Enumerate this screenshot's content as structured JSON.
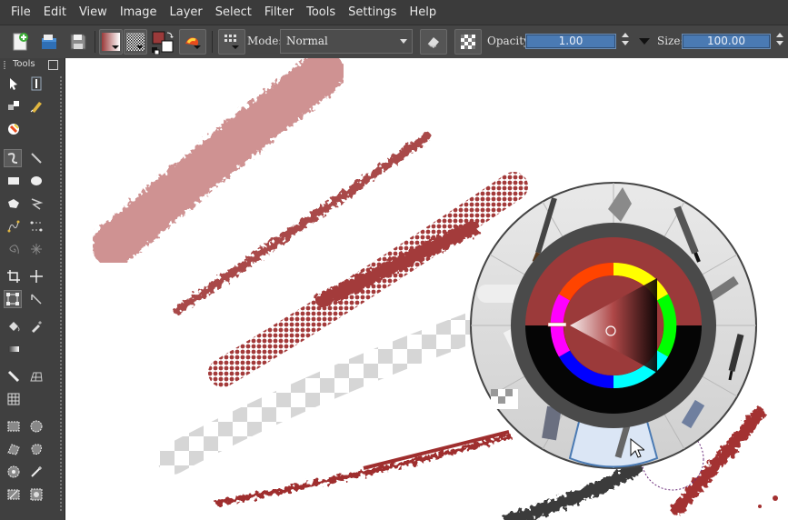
{
  "menu": [
    "File",
    "Edit",
    "View",
    "Image",
    "Layer",
    "Select",
    "Filter",
    "Tools",
    "Settings",
    "Help"
  ],
  "toolbar": {
    "mode_label": "Mode:",
    "blend_mode": "Normal",
    "opacity_label": "Opacity:",
    "opacity_value": "1.00",
    "size_label": "Size:",
    "size_value": "100.00"
  },
  "tools_panel": {
    "title": "Tools"
  },
  "colors": {
    "foreground": "#9b3a3a",
    "background": "#ffffff",
    "accent": "#4a7ab3",
    "panel": "#404040"
  },
  "icons": [
    "new-document-icon",
    "open-icon",
    "save-icon",
    "gradient-icon",
    "pattern-icon",
    "swap-colors-icon",
    "brush-preset-icon",
    "grid-icon",
    "eraser-icon",
    "alpha-lock-icon"
  ],
  "popup_palette": {
    "current_color": "#9b3a3a",
    "brush_presets": 12
  }
}
